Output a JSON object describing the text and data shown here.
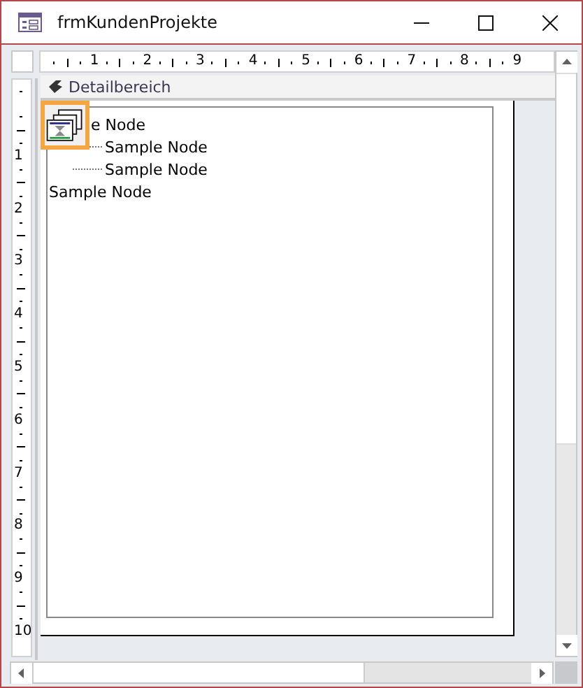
{
  "window": {
    "title": "frmKundenProjekte"
  },
  "ruler": {
    "horizontal": [
      "1",
      "2",
      "3",
      "4",
      "5",
      "6",
      "7",
      "8",
      "9"
    ],
    "vertical": [
      "1",
      "2",
      "3",
      "4",
      "5",
      "6",
      "7",
      "8",
      "9",
      "10"
    ]
  },
  "section": {
    "label": "Detailbereich"
  },
  "tree": {
    "nodes": [
      {
        "label": "e Node",
        "covered": true,
        "children": [
          {
            "label": "Sample Node"
          },
          {
            "label": "Sample Node"
          }
        ]
      },
      {
        "label": "Sample Node",
        "covered": false
      }
    ]
  }
}
